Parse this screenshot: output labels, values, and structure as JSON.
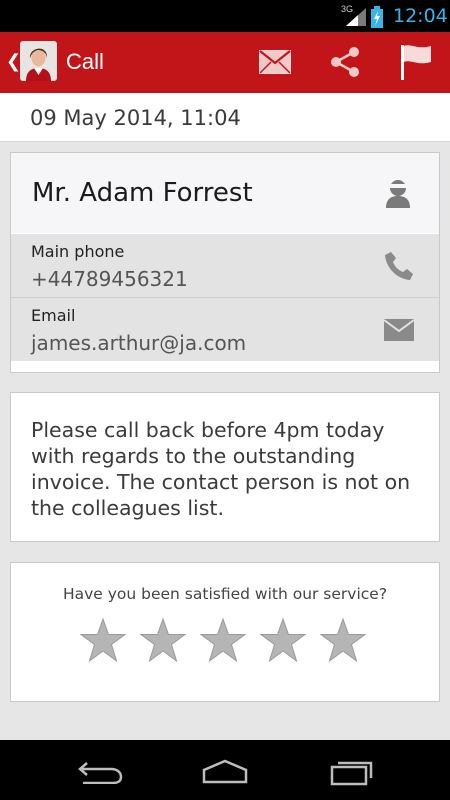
{
  "status_bar": {
    "network": "3G",
    "time": "12:04",
    "time_color": "#39b4e6"
  },
  "action_bar": {
    "title": "Call",
    "back_glyph": "❮",
    "background_color": "#c11519",
    "icons": [
      "avatar",
      "mail-icon",
      "share-icon",
      "flag-icon"
    ]
  },
  "date": "09 May 2014, 11:04",
  "contact": {
    "name": "Mr. Adam Forrest",
    "fields": [
      {
        "label": "Main phone",
        "value": "+44789456321",
        "icon": "phone-icon"
      },
      {
        "label": "Email",
        "value": "james.arthur@ja.com",
        "icon": "mail-icon"
      }
    ]
  },
  "note": "Please call back before 4pm today with regards to the outstanding invoice. The contact person is not on the colleagues list.",
  "rating": {
    "question": "Have you been satisfied with our service?",
    "max_stars": 5,
    "selected_stars": 0,
    "star_color": "#b5b5b5"
  },
  "nav_bar": {
    "buttons": [
      "back-icon",
      "home-icon",
      "recent-apps-icon"
    ]
  }
}
